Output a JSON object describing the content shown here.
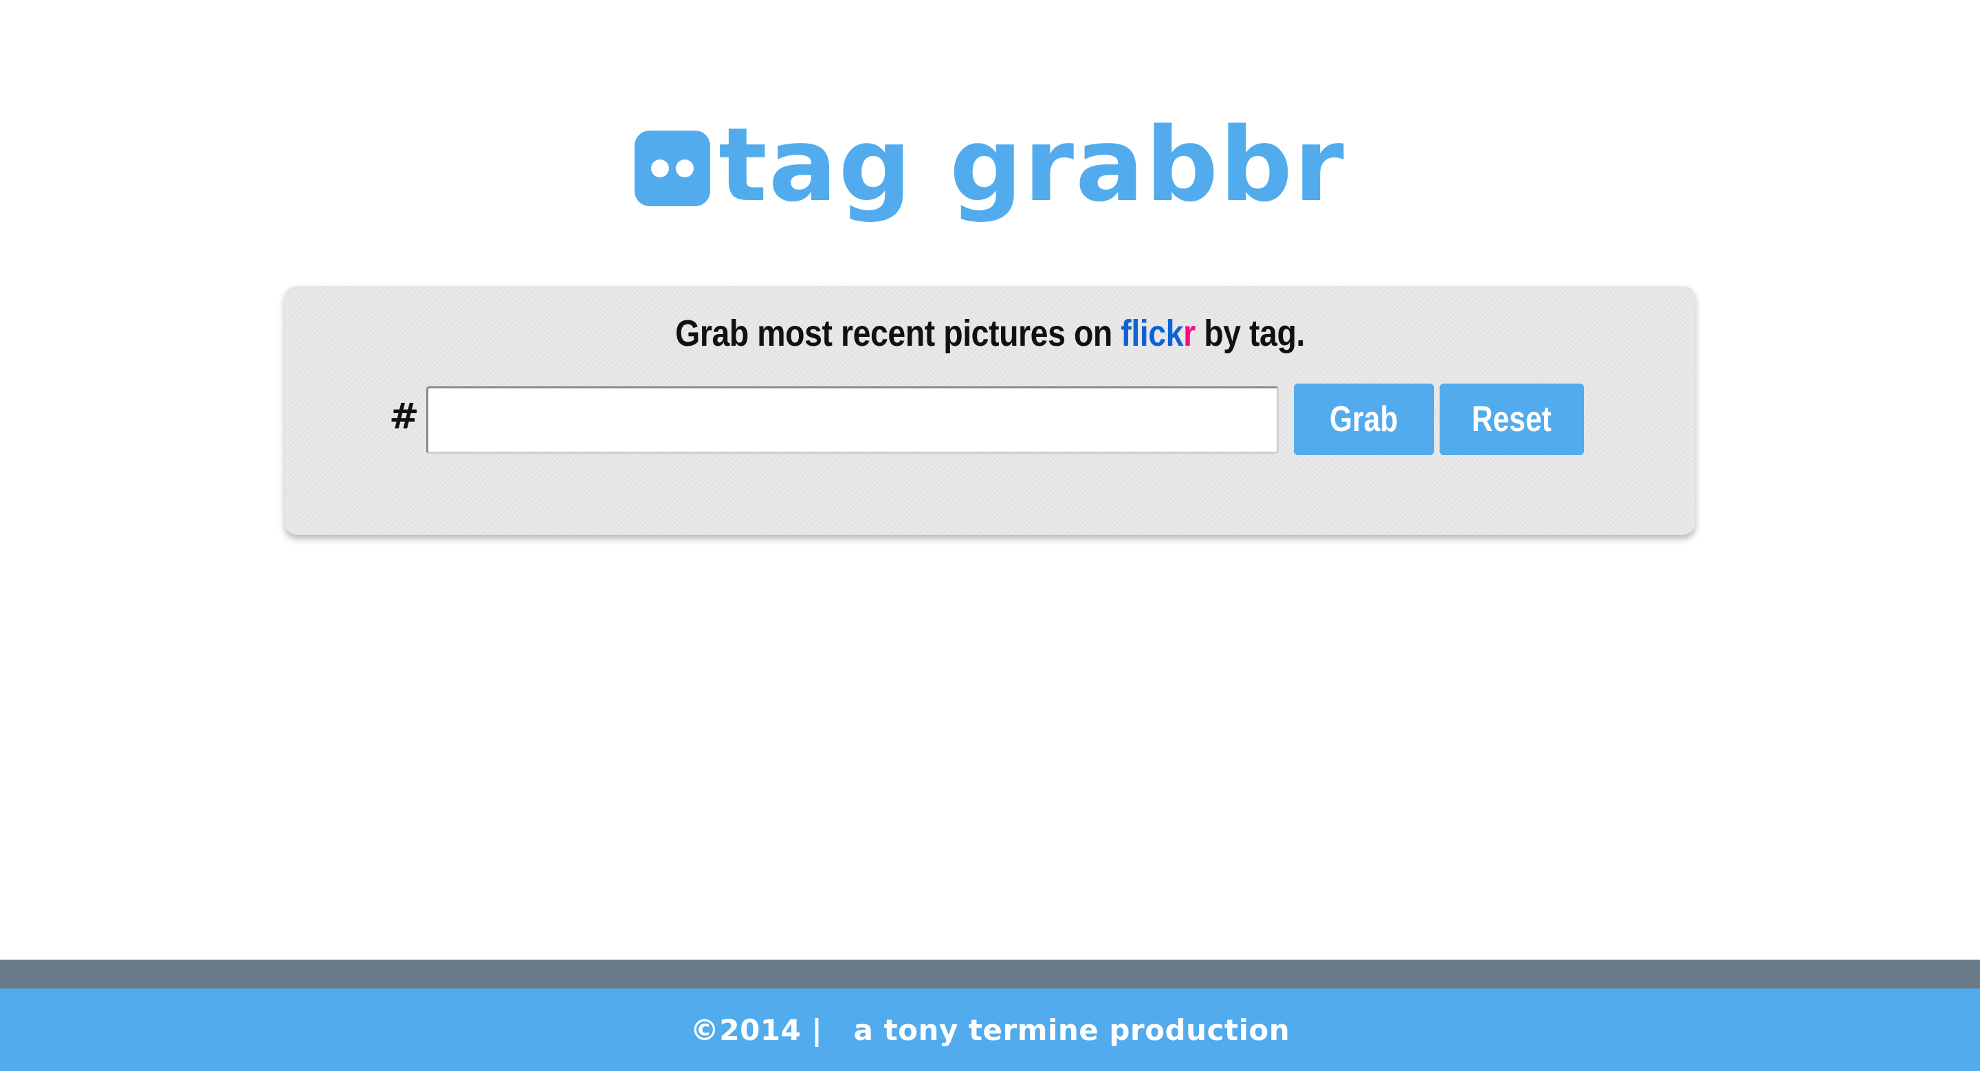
{
  "colors": {
    "accent": "#52abed",
    "flickr_blue": "#0d63d6",
    "flickr_pink": "#ff0a84",
    "footer_band": "#69798a"
  },
  "logo": {
    "icon": "flickr-logo-icon",
    "text": "tag grabbr"
  },
  "panel": {
    "headline_prefix": "Grab most recent pictures on ",
    "flickr_part1": "flick",
    "flickr_part2": "r",
    "headline_suffix": " by tag.",
    "hash_label": "#",
    "tag_input": {
      "value": "",
      "placeholder": ""
    },
    "grab_button": "Grab",
    "reset_button": "Reset"
  },
  "footer": {
    "copyright": "©2014 |   a tony termine production"
  }
}
